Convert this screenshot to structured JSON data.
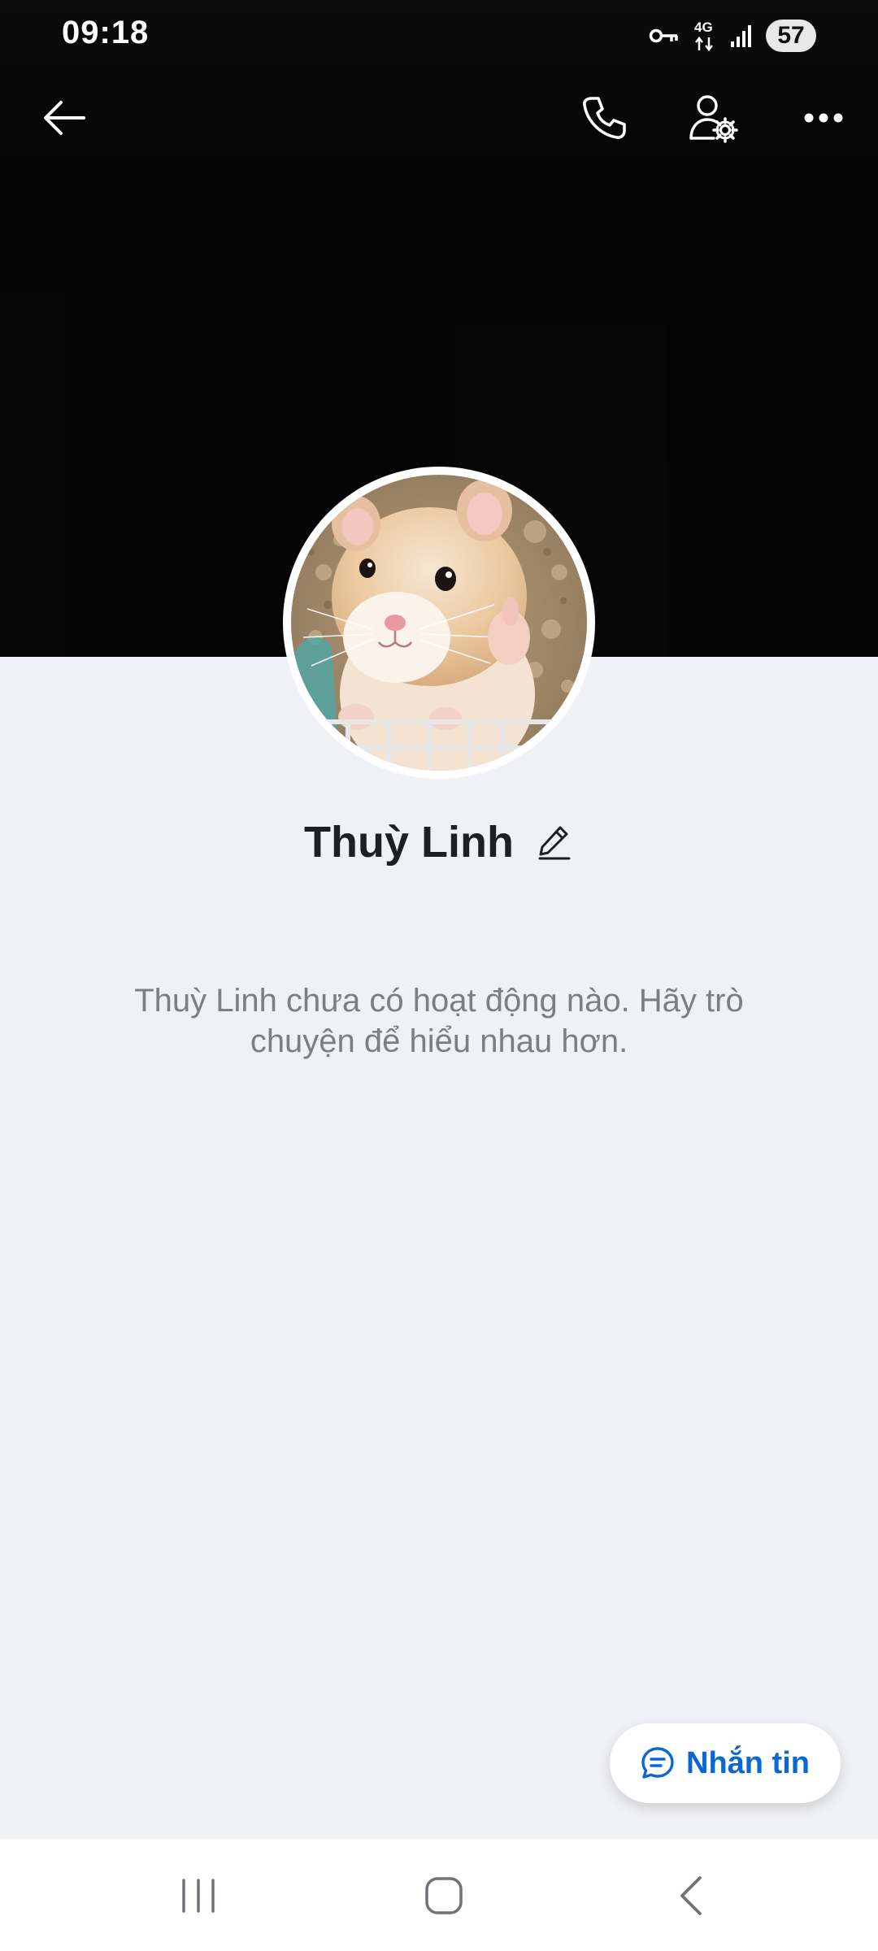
{
  "status_bar": {
    "time": "09:18",
    "network": "4G",
    "battery": "57",
    "icons": [
      "vpn-key-icon",
      "network-4g-icon",
      "signal-icon",
      "battery-icon"
    ]
  },
  "app_bar": {
    "icons": [
      "back-arrow-icon",
      "phone-icon",
      "user-settings-icon",
      "more-icon"
    ]
  },
  "profile": {
    "name": "Thuỳ Linh",
    "avatar_icon": "hamster-photo",
    "edit_icon": "pencil-icon"
  },
  "empty_state": {
    "message": "Thuỳ Linh chưa có hoạt động nào. Hãy trò chuyện để hiểu nhau hơn."
  },
  "fab": {
    "label": "Nhắn tin",
    "icon": "chat-bubble-icon"
  },
  "nav_bar": {
    "icons": [
      "recent-apps-icon",
      "home-icon",
      "back-icon"
    ]
  },
  "colors": {
    "cover": "#050505",
    "background": "#f0f1f5",
    "accent": "#0a68d6",
    "name_text": "#1d1f24",
    "muted_text": "#7a7e85"
  }
}
